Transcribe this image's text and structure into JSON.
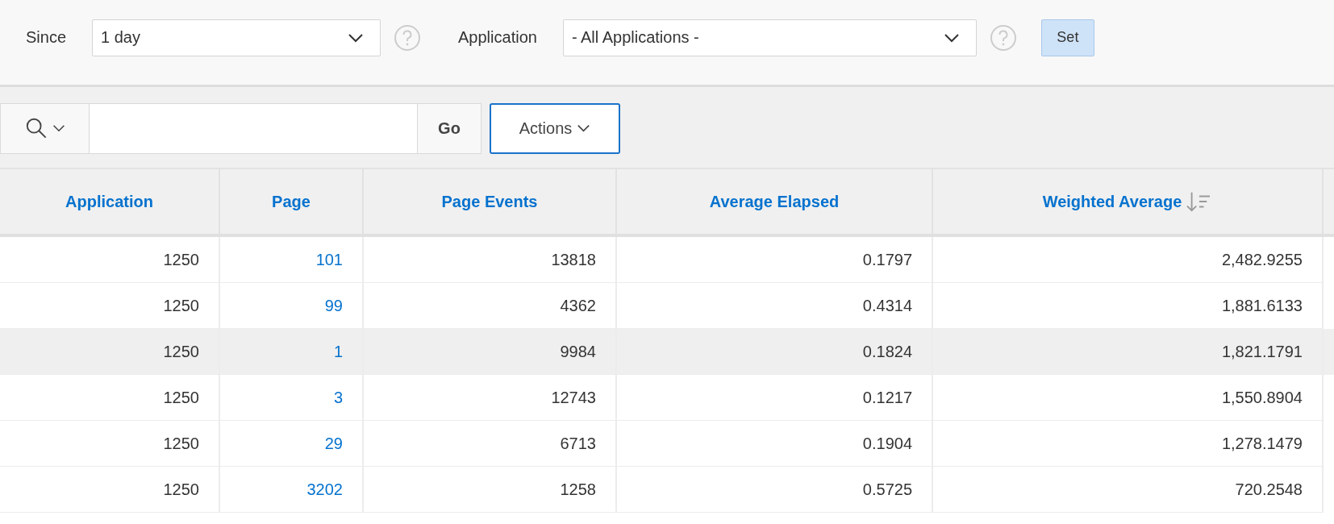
{
  "filters": [
    {
      "label": "Since",
      "value": "1 day"
    },
    {
      "label": "Application",
      "value": "- All Applications -"
    }
  ],
  "set_button": "Set",
  "toolbar": {
    "go_button": "Go",
    "actions_button": "Actions"
  },
  "table": {
    "columns": [
      {
        "label": "Application",
        "sorted": false
      },
      {
        "label": "Page",
        "sorted": false
      },
      {
        "label": "Page Events",
        "sorted": false
      },
      {
        "label": "Average Elapsed",
        "sorted": false
      },
      {
        "label": "Weighted Average",
        "sorted": true
      }
    ],
    "rows": [
      {
        "selected": false,
        "cells": [
          "1250",
          "101",
          "13818",
          "0.1797",
          "2,482.9255"
        ]
      },
      {
        "selected": false,
        "cells": [
          "1250",
          "99",
          "4362",
          "0.4314",
          "1,881.6133"
        ]
      },
      {
        "selected": true,
        "cells": [
          "1250",
          "1",
          "9984",
          "0.1824",
          "1,821.1791"
        ]
      },
      {
        "selected": false,
        "cells": [
          "1250",
          "3",
          "12743",
          "0.1217",
          "1,550.8904"
        ]
      },
      {
        "selected": false,
        "cells": [
          "1250",
          "29",
          "6713",
          "0.1904",
          "1,278.1479"
        ]
      },
      {
        "selected": false,
        "cells": [
          "1250",
          "3202",
          "1258",
          "0.5725",
          "720.2548"
        ]
      }
    ]
  }
}
